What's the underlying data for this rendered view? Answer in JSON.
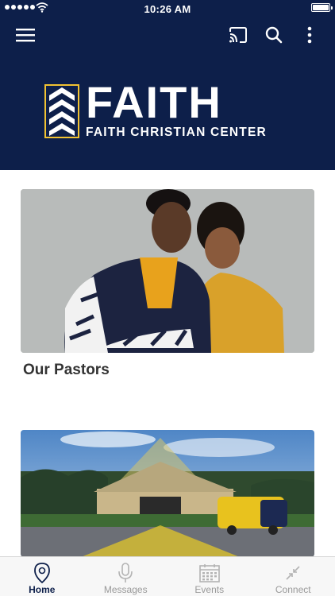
{
  "status_bar": {
    "time": "10:26 AM"
  },
  "header": {
    "logo_word": "FAITH",
    "logo_subtitle": "FAITH CHRISTIAN CENTER",
    "brand_color": "#0d1f4a",
    "accent_color": "#f1c232",
    "icons": [
      "menu-icon",
      "cast-icon",
      "search-icon",
      "more-vertical-icon"
    ]
  },
  "cards": [
    {
      "title": "Our Pastors",
      "image": "pastors-photo"
    },
    {
      "title": "",
      "image": "church-building-photo"
    }
  ],
  "tabbar": {
    "tabs": [
      {
        "label": "Home",
        "icon": "location-pin-icon",
        "active": true
      },
      {
        "label": "Messages",
        "icon": "microphone-icon",
        "active": false
      },
      {
        "label": "Events",
        "icon": "calendar-icon",
        "active": false
      },
      {
        "label": "Connect",
        "icon": "connect-arrows-icon",
        "active": false
      }
    ]
  }
}
